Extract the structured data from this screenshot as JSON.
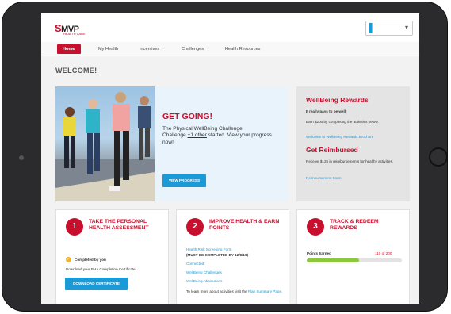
{
  "brand": {
    "logo": "MVP",
    "logo_sub": "HEALTH CARE"
  },
  "header": {
    "user_initial": "▌",
    "user_menu_icon": "chevron-down-icon"
  },
  "nav": {
    "items": [
      {
        "label": "Home",
        "active": true
      },
      {
        "label": "My Health",
        "active": false
      },
      {
        "label": "Incentives",
        "active": false
      },
      {
        "label": "Challenges",
        "active": false
      },
      {
        "label": "Health Resources",
        "active": false
      }
    ]
  },
  "page": {
    "title": "WELCOME!"
  },
  "hero": {
    "title": "GET GOING!",
    "text_1": "The Physical WellBeing Challenge",
    "text_2_pre": "Challenge ",
    "text_2_link": "+1 other",
    "text_2_post": " started. View your progress now!",
    "button": "VIEW PROGRESS"
  },
  "rewards": {
    "title": "WellBeing Rewards",
    "tagline": "It really pays to be well!",
    "earn_text": "Earn $200 by completing the activities below.",
    "brochure_link": "Welcome to WellBeing Rewards Brochure",
    "reimb_title": "Get Reimbursed",
    "reimb_text": "Receive $125 in reimbursements for healthy activities.",
    "reimb_link": "Reimbursement Form"
  },
  "cards": [
    {
      "number": "1",
      "title": "TAKE THE PERSONAL HEALTH ASSESSMENT",
      "completed": "Completed by you",
      "download_text": "Download your PHA Completion Certificate",
      "button": "DOWNLOAD CERTIFICATE"
    },
    {
      "number": "2",
      "title": "IMPROVE HEALTH & EARN POINTS",
      "link_1": "Health Risk Screening Form",
      "note_1": "(MUST BE COMPLETED BY 12/8/19)",
      "link_2": "Connected!",
      "link_3": "WellBeing Challenges",
      "link_4": "WellBeing Absolutions",
      "more_pre": "To learn more about activities visit the ",
      "more_link": "Plan Summary Page."
    },
    {
      "number": "3",
      "title": "TRACK & REDEEM REWARDS",
      "points_label": "Points Earned",
      "points_value": "110 of 200",
      "points_fraction": 0.55
    }
  ],
  "colors": {
    "brand_red": "#c8102e",
    "link_blue": "#1a9ad6",
    "progress_green": "#8dc63f"
  }
}
